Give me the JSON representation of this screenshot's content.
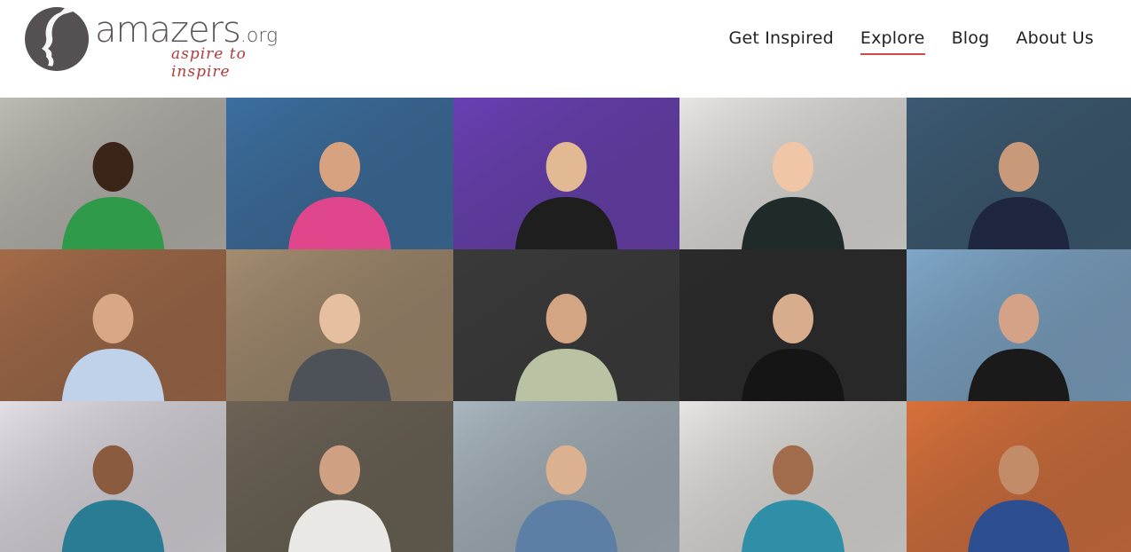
{
  "logo": {
    "word": "amazers",
    "domain": ".org",
    "tagline": "aspire to inspire"
  },
  "nav": {
    "items": [
      {
        "label": "Get Inspired",
        "active": false
      },
      {
        "label": "Explore",
        "active": true
      },
      {
        "label": "Blog",
        "active": false
      },
      {
        "label": "About Us",
        "active": false
      }
    ]
  },
  "colors": {
    "accent": "#d04a45",
    "logo_gray": "#555152",
    "tagline": "#b13a3a"
  },
  "tiles": [
    {
      "name": "tile-man-green-shirt-bicycle",
      "bg": "#bdbab3",
      "shirt": "#2e9a4a",
      "skin": "#3b2418"
    },
    {
      "name": "tile-surfer-pink-bikini",
      "bg": "#3b6fa1",
      "shirt": "#e0468b",
      "skin": "#d7a27f"
    },
    {
      "name": "tile-woman-purple-boat",
      "bg": "#6a3fb5",
      "shirt": "#1e1e1e",
      "skin": "#e3b993"
    },
    {
      "name": "tile-two-women-ribbons",
      "bg": "#e9e6e2",
      "shirt": "#1f2a2a",
      "skin": "#f1c6a6"
    },
    {
      "name": "tile-man-beanie-ocean",
      "bg": "#3b5a73",
      "shirt": "#1f2640",
      "skin": "#c89a7a"
    },
    {
      "name": "tile-couple-office",
      "bg": "#a56b48",
      "shirt": "#bfd2ea",
      "skin": "#d8a886"
    },
    {
      "name": "tile-woman-wood-wall",
      "bg": "#a48c6f",
      "shirt": "#4d5258",
      "skin": "#e6bfa0"
    },
    {
      "name": "tile-man-long-hair-stripes",
      "bg": "#3a3a3a",
      "shirt": "#b9c3a4",
      "skin": "#d4a582"
    },
    {
      "name": "tile-man-with-robot",
      "bg": "#2a2a2a",
      "shirt": "#151515",
      "skin": "#d8ad8e"
    },
    {
      "name": "tile-swimmer-wetsuit-camera",
      "bg": "#7fa7c9",
      "shirt": "#1a1a1a",
      "skin": "#d4a286"
    },
    {
      "name": "tile-man-pointing-laptop",
      "bg": "#e2dfe6",
      "shirt": "#2a7c94",
      "skin": "#8a5b3f"
    },
    {
      "name": "tile-man-stone-wall",
      "bg": "#6d6456",
      "shirt": "#e9e8e4",
      "skin": "#d0a082"
    },
    {
      "name": "tile-pilot-airplane",
      "bg": "#a9b6bf",
      "shirt": "#5d7fa6",
      "skin": "#dcb190"
    },
    {
      "name": "tile-woman-sari-chair",
      "bg": "#e8e6e2",
      "shirt": "#2e8fa6",
      "skin": "#a16c4c"
    },
    {
      "name": "tile-man-sunset-jacket",
      "bg": "#d9713b",
      "shirt": "#2e4f8f",
      "skin": "#c38c69"
    }
  ]
}
